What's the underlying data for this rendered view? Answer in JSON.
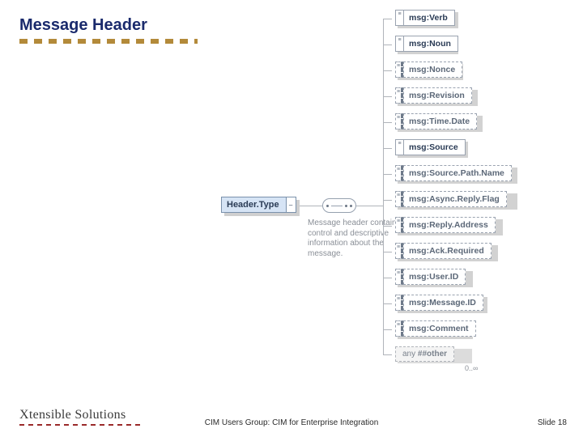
{
  "title": "Message Header",
  "root": {
    "label": "Header.Type",
    "annotation": "Message header contains control and descriptive information about the message."
  },
  "children": [
    {
      "label": "msg:Verb",
      "optional": false
    },
    {
      "label": "msg:Noun",
      "optional": false
    },
    {
      "label": "msg:Nonce",
      "optional": true
    },
    {
      "label": "msg:Revision",
      "optional": true
    },
    {
      "label": "msg:Time.Date",
      "optional": true
    },
    {
      "label": "msg:Source",
      "optional": false
    },
    {
      "label": "msg:Source.Path.Name",
      "optional": true
    },
    {
      "label": "msg:Async.Reply.Flag",
      "optional": true
    },
    {
      "label": "msg:Reply.Address",
      "optional": true
    },
    {
      "label": "msg:Ack.Required",
      "optional": true
    },
    {
      "label": "msg:User.ID",
      "optional": true
    },
    {
      "label": "msg:Message.ID",
      "optional": true
    },
    {
      "label": "msg:Comment",
      "optional": true
    }
  ],
  "any": {
    "prefix": "any",
    "namespace": "##other",
    "occurs": "0..∞"
  },
  "footer": {
    "logo": "Xtensible Solutions",
    "center": "CIM Users Group: CIM for Enterprise Integration",
    "slide": "Slide 18"
  }
}
